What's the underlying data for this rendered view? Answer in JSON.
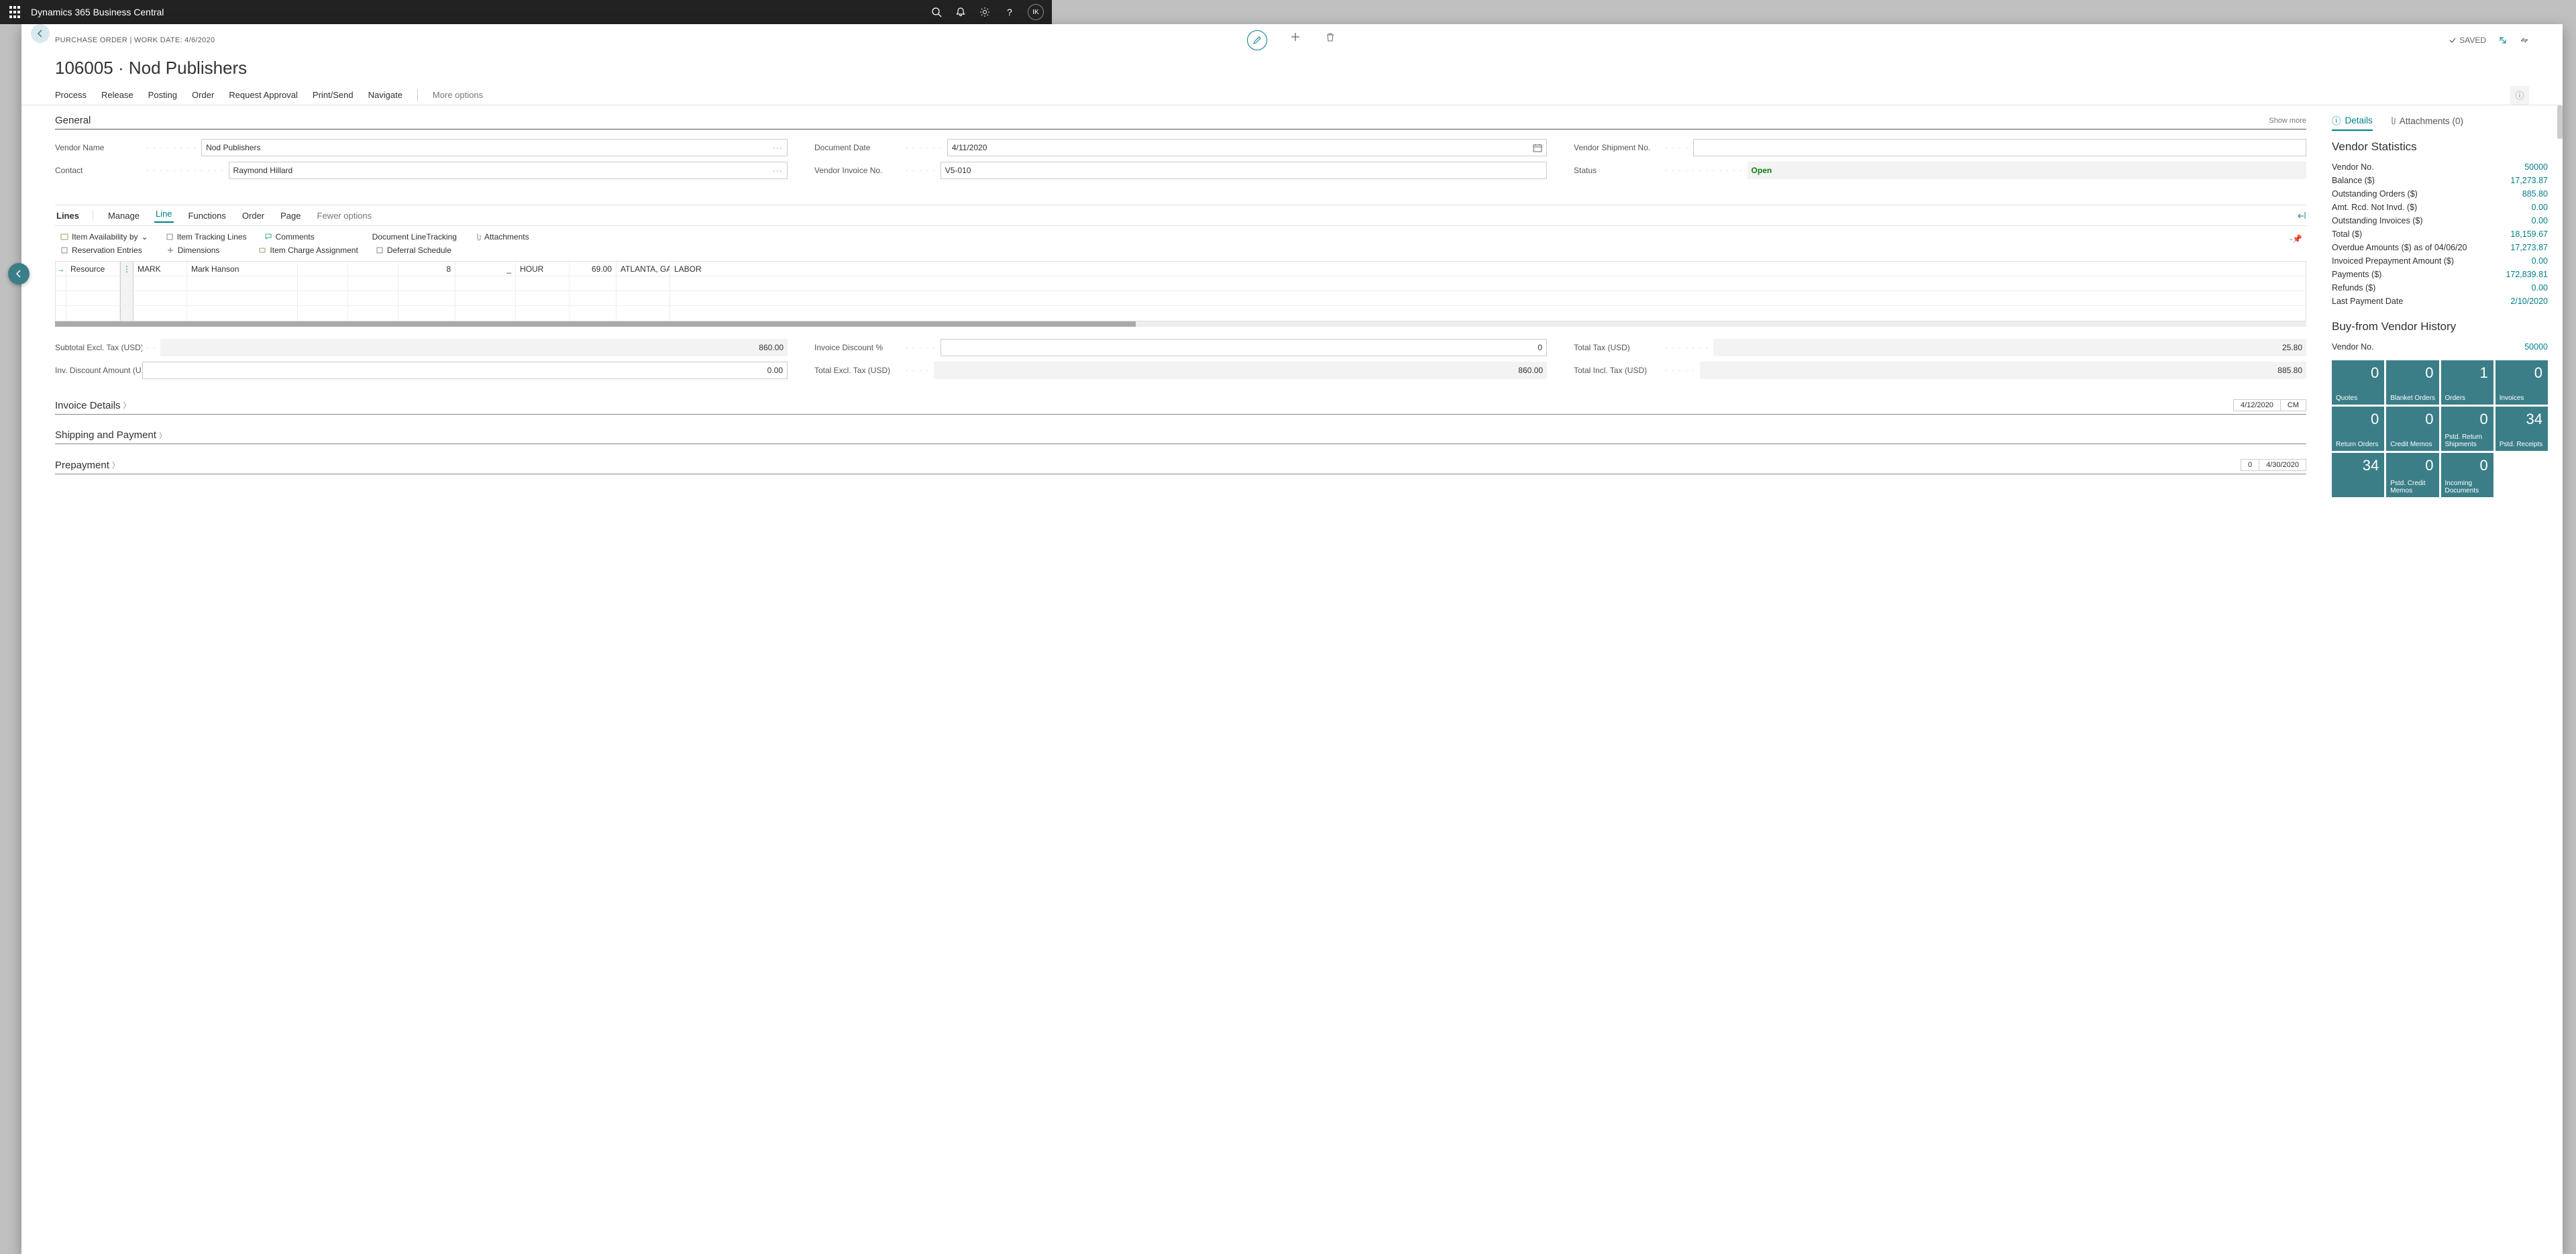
{
  "topbar": {
    "app": "Dynamics 365 Business Central",
    "avatar": "IK"
  },
  "page": {
    "crumb": "PURCHASE ORDER | WORK DATE: 4/6/2020",
    "title": "106005 · Nod Publishers",
    "saved": "SAVED"
  },
  "actions": {
    "process": "Process",
    "release": "Release",
    "posting": "Posting",
    "order": "Order",
    "requestApproval": "Request Approval",
    "printSend": "Print/Send",
    "navigate": "Navigate",
    "more": "More options"
  },
  "general": {
    "header": "General",
    "showMore": "Show more",
    "vendorNameLabel": "Vendor Name",
    "vendorName": "Nod Publishers",
    "contactLabel": "Contact",
    "contact": "Raymond Hillard",
    "docDateLabel": "Document Date",
    "docDate": "4/11/2020",
    "vendInvNoLabel": "Vendor Invoice No.",
    "vendInvNo": "V5-010",
    "vendShipNoLabel": "Vendor Shipment No.",
    "vendShipNo": "",
    "statusLabel": "Status",
    "status": "Open"
  },
  "lines": {
    "header": "Lines",
    "tabs": {
      "manage": "Manage",
      "line": "Line",
      "functions": "Functions",
      "order": "Order",
      "page": "Page",
      "fewer": "Fewer options"
    },
    "sub": {
      "itemAvail": "Item Availability by",
      "tracking": "Item Tracking Lines",
      "comments": "Comments",
      "docLineTrack": "Document LineTracking",
      "attachments": "Attachments",
      "reservation": "Reservation Entries",
      "dimensions": "Dimensions",
      "charge": "Item Charge Assignment",
      "deferral": "Deferral Schedule"
    },
    "row": {
      "type": "Resource",
      "no": "MARK",
      "desc": "Mark Hanson",
      "qty": "8",
      "reserved": "_",
      "uom": "HOUR",
      "cost": "69.00",
      "taxArea": "ATLANTA, GA",
      "taxGroup": "LABOR"
    }
  },
  "totals": {
    "subtotalLabel": "Subtotal Excl. Tax (USD)",
    "subtotal": "860.00",
    "invDiscAmtLabel": "Inv. Discount Amount (U...",
    "invDiscAmt": "0.00",
    "invDiscPctLabel": "Invoice Discount %",
    "invDiscPct": "0",
    "totalExclLabel": "Total Excl. Tax (USD)",
    "totalExcl": "860.00",
    "totalTaxLabel": "Total Tax (USD)",
    "totalTax": "25.80",
    "totalInclLabel": "Total Incl. Tax (USD)",
    "totalIncl": "885.80"
  },
  "sections": {
    "invoiceDetails": "Invoice Details",
    "invoicePill1": "4/12/2020",
    "invoicePill2": "CM",
    "shipping": "Shipping and Payment",
    "prepayment": "Prepayment",
    "prepayPill1": "0",
    "prepayPill2": "4/30/2020"
  },
  "factbox": {
    "detailsTab": "Details",
    "attachTab": "Attachments (0)",
    "vendStatsHeader": "Vendor Statistics",
    "stats": {
      "vendorNoL": "Vendor No.",
      "vendorNo": "50000",
      "balanceL": "Balance ($)",
      "balance": "17,273.87",
      "outOrdersL": "Outstanding Orders ($)",
      "outOrders": "885.80",
      "amtRcdL": "Amt. Rcd. Not Invd. ($)",
      "amtRcd": "0.00",
      "outInvL": "Outstanding Invoices ($)",
      "outInv": "0.00",
      "totalL": "Total ($)",
      "total": "18,159.67",
      "overdueL": "Overdue Amounts ($) as of 04/06/20",
      "overdue": "17,273.87",
      "invPrepayL": "Invoiced Prepayment Amount ($)",
      "invPrepay": "0.00",
      "paymentsL": "Payments ($)",
      "payments": "172,839.81",
      "refundsL": "Refunds ($)",
      "refunds": "0.00",
      "lastPayL": "Last Payment Date",
      "lastPay": "2/10/2020"
    },
    "historyHeader": "Buy-from Vendor History",
    "histVendorNoL": "Vendor No.",
    "histVendorNo": "50000",
    "tiles": [
      {
        "n": "0",
        "l": "Quotes"
      },
      {
        "n": "0",
        "l": "Blanket Orders"
      },
      {
        "n": "1",
        "l": "Orders"
      },
      {
        "n": "0",
        "l": "Invoices"
      },
      {
        "n": "0",
        "l": "Return Orders"
      },
      {
        "n": "0",
        "l": "Credit Memos"
      },
      {
        "n": "0",
        "l": "Pstd. Return Shipments"
      },
      {
        "n": "34",
        "l": "Pstd. Receipts"
      },
      {
        "n": "34",
        "l": ""
      },
      {
        "n": "0",
        "l": "Pstd. Credit Memos"
      },
      {
        "n": "0",
        "l": "Incoming Documents"
      }
    ]
  }
}
